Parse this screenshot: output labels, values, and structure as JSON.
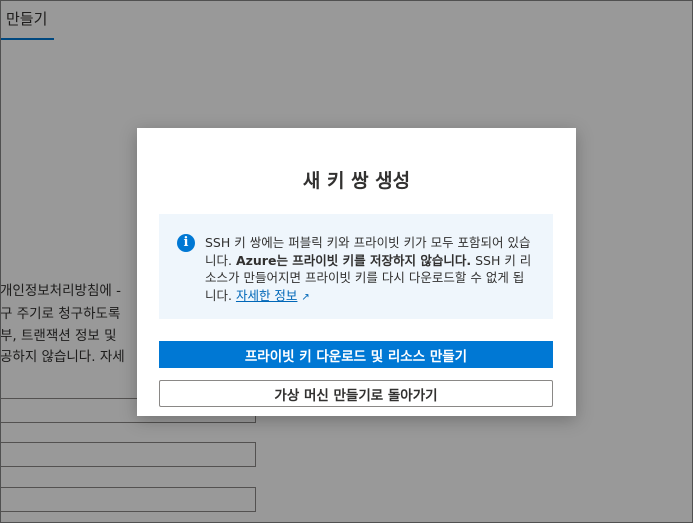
{
  "background": {
    "tab_title": "만들기",
    "lines": [
      "개인정보처리방침에 -",
      "구 주기로 청구하도록",
      "부, 트랜잭션 정보 및",
      "공하지 않습니다. 자세"
    ]
  },
  "dialog": {
    "title": "새 키 쌍 생성",
    "info": {
      "text_1": "SSH 키 쌍에는 퍼블릭 키와 프라이빗 키가 모두 포함되어 있습니다. ",
      "text_bold": "Azure는 프라이빗 키를 저장하지 않습니다.",
      "text_2": " SSH 키 리소스가 만들어지면 프라이빗 키를 다시 다운로드할 수 없게 됩니다. ",
      "link": "자세한 정보"
    },
    "primary_button": "프라이빗 키 다운로드 및 리소스 만들기",
    "secondary_button": "가상 머신 만들기로 돌아가기"
  },
  "colors": {
    "accent": "#0078d4",
    "info_bg": "#eff6fc"
  },
  "icons": {
    "info": "info-icon",
    "external_link": "external-link-icon"
  }
}
